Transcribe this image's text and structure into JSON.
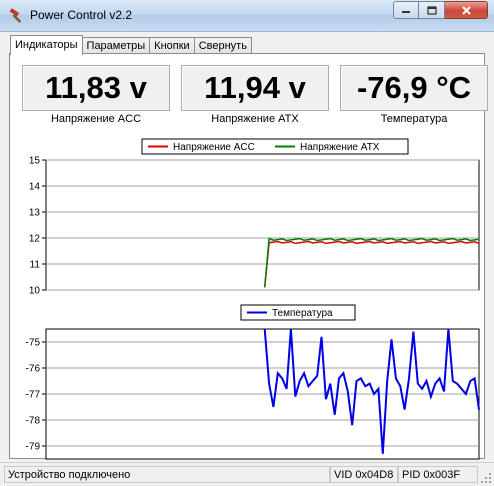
{
  "window": {
    "title": "Power Control v2.2"
  },
  "tabs": [
    "Индикаторы",
    "Параметры",
    "Кнопки",
    "Свернуть"
  ],
  "gauges": [
    {
      "value": "11,83 v",
      "label": "Напряжение ACC"
    },
    {
      "value": "11,94 v",
      "label": "Напряжение ATX"
    },
    {
      "value": "-76,9 °C",
      "label": "Температура"
    }
  ],
  "colors": {
    "acc": "#e00000",
    "atx": "#008000",
    "temp": "#0000e6"
  },
  "chart_data": [
    {
      "type": "line",
      "legend": [
        "Напряжение ACC",
        "Напряжение ATX"
      ],
      "legend_position": "top-center",
      "ylim": [
        10,
        15
      ],
      "yticks": [
        10,
        11,
        12,
        13,
        14,
        15
      ],
      "grid": true,
      "n_points": 100,
      "start_index": 50,
      "series": [
        {
          "name": "Напряжение ACC",
          "start": 10.1,
          "level": 11.83
        },
        {
          "name": "Напряжение ATX",
          "start": 10.1,
          "level": 11.94
        }
      ]
    },
    {
      "type": "line",
      "legend": [
        "Температура"
      ],
      "legend_position": "top-center",
      "ylim": [
        -79.5,
        -74.5
      ],
      "yticks": [
        -75,
        -76,
        -77,
        -78,
        -79
      ],
      "grid": true,
      "n_points": 100,
      "start_index": 50,
      "series": [
        {
          "name": "Температура",
          "values": [
            -74.5,
            -76.6,
            -77.5,
            -76.2,
            -76.4,
            -76.8,
            -74.5,
            -77.1,
            -76.5,
            -76.2,
            -76.7,
            -76.5,
            -76.3,
            -74.8,
            -77.2,
            -76.6,
            -77.8,
            -76.4,
            -76.2,
            -76.9,
            -78.2,
            -76.5,
            -76.4,
            -76.7,
            -76.6,
            -77.0,
            -76.8,
            -79.3,
            -76.5,
            -74.9,
            -76.4,
            -76.7,
            -77.6,
            -76.4,
            -74.6,
            -76.6,
            -76.8,
            -76.5,
            -77.1,
            -76.6,
            -76.4,
            -76.9,
            -74.5,
            -76.5,
            -76.6,
            -76.8,
            -77.0,
            -76.5,
            -76.4,
            -77.6
          ]
        }
      ]
    }
  ],
  "status": {
    "text": "Устройство подключено",
    "vid": "VID 0x04D8",
    "pid": "PID 0x003F"
  }
}
